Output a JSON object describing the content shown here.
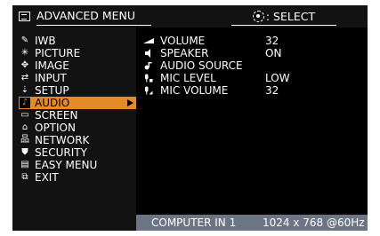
{
  "header": {
    "title": "ADVANCED MENU",
    "hint": ": SELECT"
  },
  "sidebar": {
    "items": [
      {
        "label": "IWB",
        "icon": "iwb-icon",
        "glyph": "✎"
      },
      {
        "label": "PICTURE",
        "icon": "picture-icon",
        "glyph": "✳"
      },
      {
        "label": "IMAGE",
        "icon": "image-icon",
        "glyph": "✥"
      },
      {
        "label": "INPUT",
        "icon": "input-icon",
        "glyph": "⇄"
      },
      {
        "label": "SETUP",
        "icon": "setup-icon",
        "glyph": "⇣"
      },
      {
        "label": "AUDIO",
        "icon": "audio-icon",
        "glyph": "♪"
      },
      {
        "label": "SCREEN",
        "icon": "screen-icon",
        "glyph": "▭"
      },
      {
        "label": "OPTION",
        "icon": "option-icon",
        "glyph": "⌂"
      },
      {
        "label": "NETWORK",
        "icon": "network-icon",
        "glyph": "品"
      },
      {
        "label": "SECURITY",
        "icon": "security-icon",
        "glyph": "⛊"
      },
      {
        "label": "EASY MENU",
        "icon": "easy-menu-icon",
        "glyph": "▤"
      },
      {
        "label": "EXIT",
        "icon": "exit-icon",
        "glyph": "⧉"
      }
    ],
    "active": "AUDIO"
  },
  "audio": {
    "items": [
      {
        "label": "VOLUME",
        "value": "32",
        "icon": "volume-icon"
      },
      {
        "label": "SPEAKER",
        "value": "ON",
        "icon": "speaker-icon"
      },
      {
        "label": "AUDIO SOURCE",
        "value": "",
        "icon": "audio-source-icon"
      },
      {
        "label": "MIC LEVEL",
        "value": "LOW",
        "icon": "mic-level-icon"
      },
      {
        "label": "MIC VOLUME",
        "value": "32",
        "icon": "mic-volume-icon"
      }
    ]
  },
  "status": {
    "source": "COMPUTER IN 1",
    "resolution": "1024 x 768 @60Hz"
  },
  "colors": {
    "accent": "#e48a26",
    "frame": "#6b7584",
    "panel": "#121212",
    "content": "#000000"
  }
}
